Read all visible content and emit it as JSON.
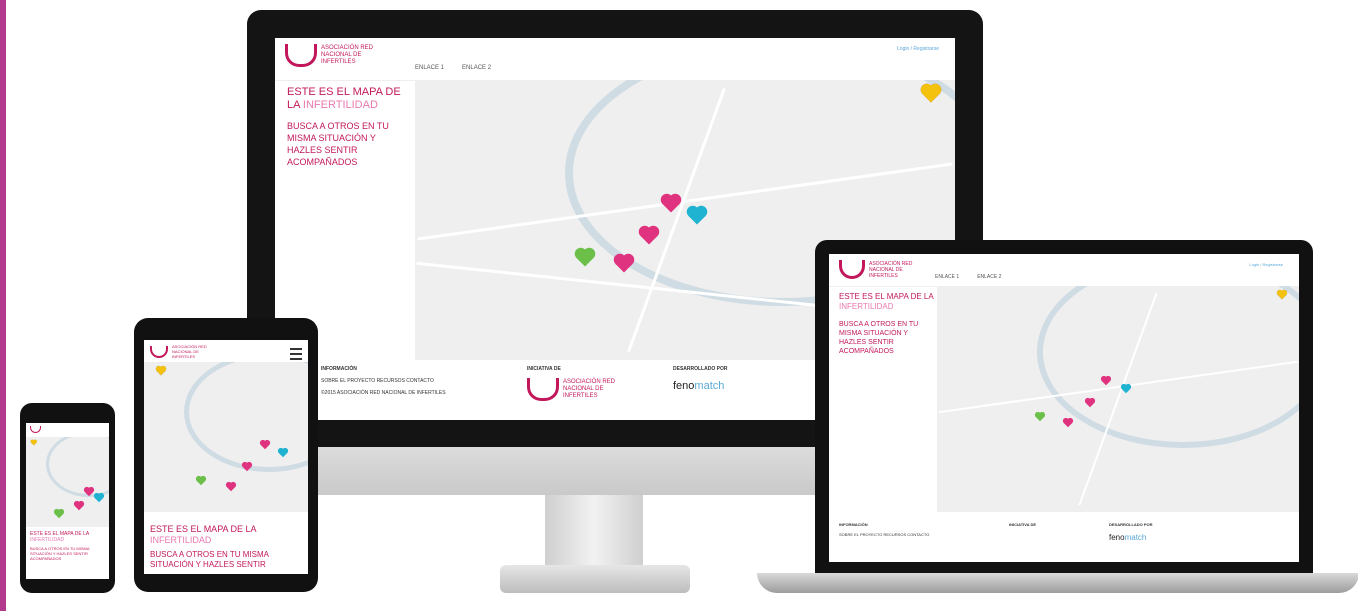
{
  "site": {
    "logo_text": "ASOCIACIÓN RED NACIONAL DE INFERTILES",
    "nav": [
      "ENLACE 1",
      "ENLACE 2"
    ],
    "login": "Login / Registrarse",
    "headline_part1": "ESTE ES EL MAPA DE LA",
    "headline_part2": "INFERTILIDAD",
    "subheadline": "BUSCA A OTROS EN TU MISMA SITUACIÓN Y HAZLES SENTIR ACOMPAÑADOS",
    "footer": {
      "info_title": "INFORMACIÓN",
      "info_links": "SOBRE EL PROYECTO   RECURSOS   CONTACTO",
      "info_small": "©2015 ASOCIACIÓN RED NACIONAL DE INFERTILES",
      "initiative_title": "INICIATIVA DE",
      "developed_title": "DESARROLLADO POR",
      "feno_brand_1": "feno",
      "feno_brand_2": "match"
    }
  },
  "tablet": {
    "headline_part1": "ESTE ES EL MAPA DE LA",
    "headline_part2": "INFERTILIDAD",
    "subheadline": "BUSCA A OTROS EN TU MISMA SITUACIÓN Y HAZLES SENTIR"
  },
  "phone": {
    "headline_part1": "ESTE ES EL MAPA DE LA",
    "headline_part2": "INFERTILIDAD",
    "subheadline": "BUSCA A OTROS EN TU MISMA SITUACIÓN Y HAZLES SENTIR ACOMPAÑADOS"
  },
  "colors": {
    "brand": "#c2185b",
    "accent_light": "#e879b0",
    "map_bg": "#efefef",
    "heart_pink": "#e0337f",
    "heart_cyan": "#1fb3d1",
    "heart_green": "#6cc04a"
  }
}
